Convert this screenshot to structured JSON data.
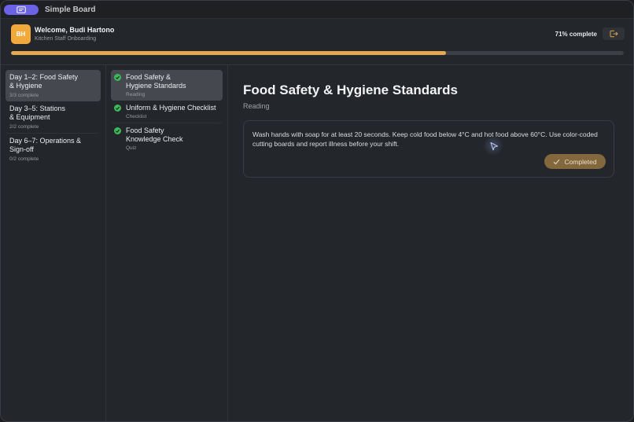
{
  "app": {
    "title": "Simple Board"
  },
  "header": {
    "avatar_initials": "BH",
    "welcome": "Welcome, Budi Hartono",
    "subtitle": "Kitchen Staff Onboarding",
    "progress_label": "71% complete",
    "progress_value": 0.71
  },
  "days": [
    {
      "title_line1": "Day 1–2: Food Safety",
      "title_line2": "& Hygiene",
      "status": "3/3 complete",
      "active": true
    },
    {
      "title_line1": "Day 3–5: Stations",
      "title_line2": "& Equipment",
      "status": "2/2 complete",
      "active": false
    },
    {
      "title_line1": "Day 6–7: Operations &",
      "title_line2": "Sign-off",
      "status": "0/2 complete",
      "active": false
    }
  ],
  "lessons": [
    {
      "title_line1": "Food Safety &",
      "title_line2": "Hygiene Standards",
      "type": "Reading",
      "active": true,
      "done": true
    },
    {
      "title_line1": "Uniform & Hygiene Checklist",
      "title_line2": "",
      "type": "Checklist",
      "active": false,
      "done": true
    },
    {
      "title_line1": "Food Safety",
      "title_line2": "Knowledge Check",
      "type": "Quiz",
      "active": false,
      "done": true
    }
  ],
  "main": {
    "title": "Food Safety & Hygiene Standards",
    "type": "Reading",
    "content": "Wash hands with soap for at least 20 seconds. Keep cold food below 4°C and hot food above 60°C. Use color-coded cutting boards and report illness before your shift.",
    "completed_label": "Completed"
  },
  "colors": {
    "accent": "#e3a851",
    "app_pill": "#6b63e6",
    "avatar": "#f2a93b",
    "check": "#3dbb5a",
    "completed_button": "#84683d"
  },
  "icons": {
    "app": "board-icon",
    "exit": "logout-icon",
    "check": "check-circle-icon",
    "completed": "checkmark-icon"
  }
}
